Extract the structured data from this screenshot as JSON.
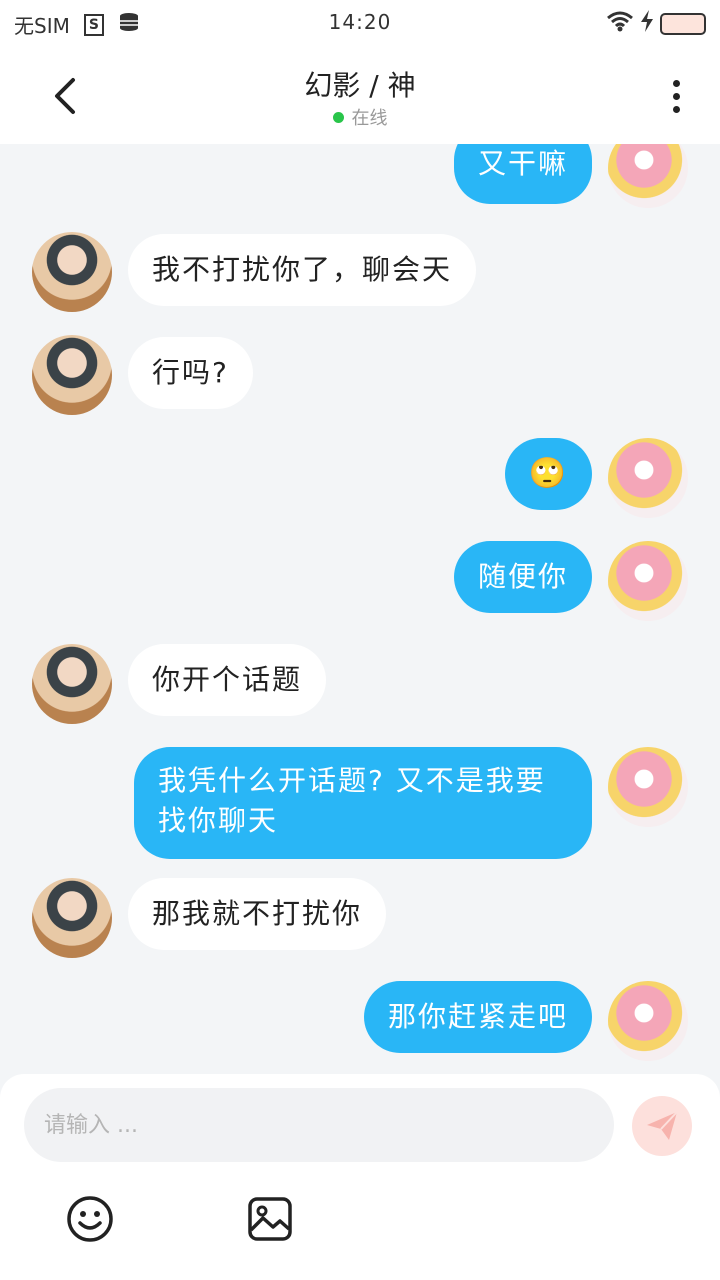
{
  "status_bar": {
    "carrier": "无SIM",
    "sim_icon": "S",
    "time": "14:20"
  },
  "header": {
    "title": "幻影 / 神",
    "status": "在线",
    "online_color": "#29c54a"
  },
  "messages": [
    {
      "side": "out",
      "text": "又干嘛"
    },
    {
      "side": "in",
      "text": "我不打扰你了，聊会天"
    },
    {
      "side": "in",
      "text": "行吗?"
    },
    {
      "side": "out",
      "text": "🙄"
    },
    {
      "side": "out",
      "text": "随便你"
    },
    {
      "side": "in",
      "text": "你开个话题"
    },
    {
      "side": "out",
      "text": "我凭什么开话题? 又不是我要找你聊天"
    },
    {
      "side": "in",
      "text": "那我就不打扰你"
    },
    {
      "side": "out",
      "text": "那你赶紧走吧"
    }
  ],
  "composer": {
    "placeholder": "请输入 ...",
    "value": ""
  },
  "colors": {
    "bubble_out": "#29b6f6",
    "bubble_in": "#ffffff",
    "background": "#f3f5f7"
  },
  "icons": [
    "back-icon",
    "more-icon",
    "send-icon",
    "emoji-icon",
    "image-icon",
    "wifi-icon",
    "charging-icon",
    "battery-icon",
    "database-icon"
  ]
}
